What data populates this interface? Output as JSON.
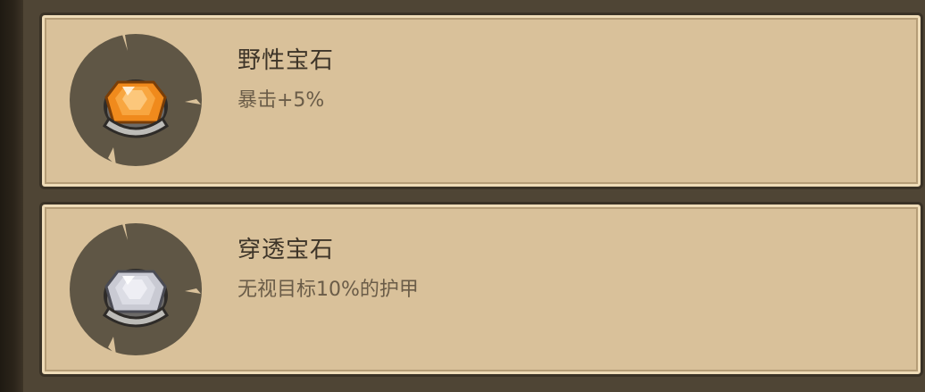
{
  "gems": [
    {
      "name": "野性宝石",
      "effect": "暴击+5%",
      "gem_color": "#f08a1c",
      "icon": "orange-gem-icon"
    },
    {
      "name": "穿透宝石",
      "effect": "无视目标10%的护甲",
      "gem_color": "#c9cad3",
      "icon": "silver-gem-icon"
    }
  ],
  "colors": {
    "card_background": "#d9c19a",
    "plate": "#5f5645",
    "title_text": "#3d3428",
    "desc_text": "#6a5c48"
  }
}
